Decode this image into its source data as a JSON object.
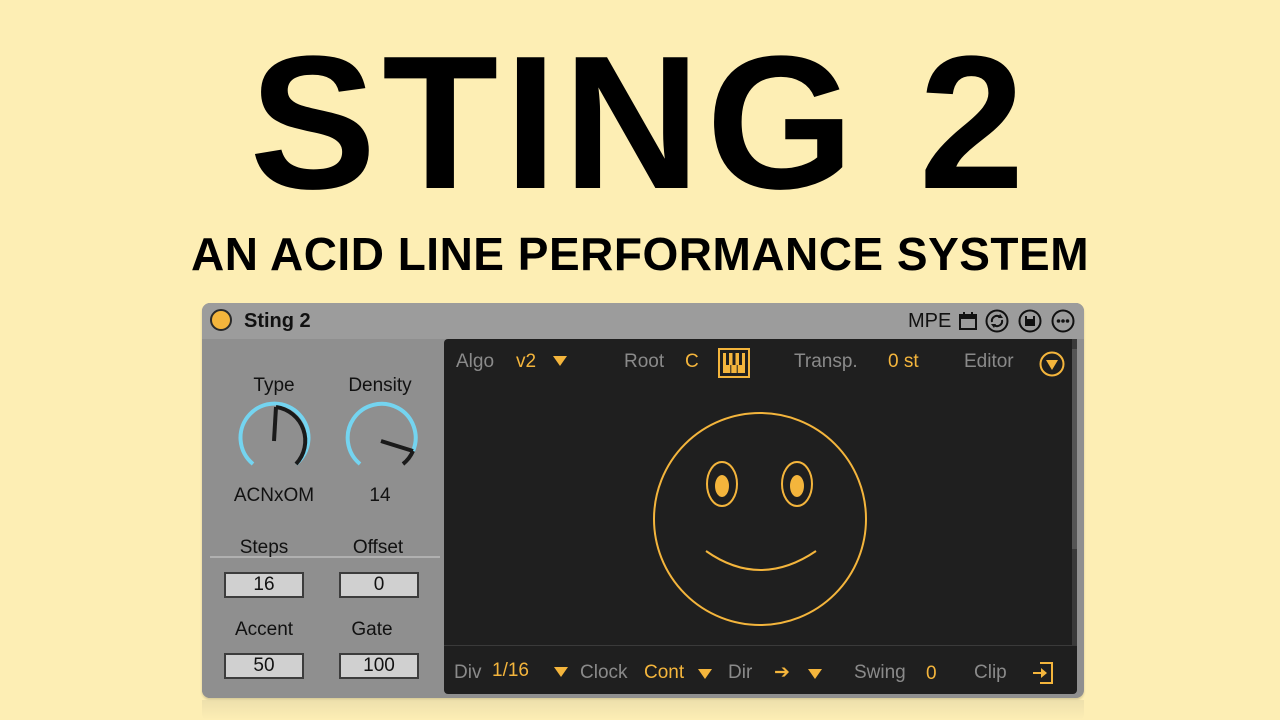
{
  "headline": "STING 2",
  "subheadline": "AN ACID LINE PERFORMANCE SYSTEM",
  "colors": {
    "background": "#fdeeb4",
    "accent": "#f4b53c",
    "knob_arc": "#74d4f0",
    "panel": "#1f1f1f"
  },
  "device": {
    "title": "Sting 2",
    "mpe_label": "MPE",
    "titlebar_icons": [
      "calendar-icon",
      "hot-swap-icon",
      "save-icon",
      "more-icon"
    ]
  },
  "left_panel": {
    "type": {
      "label": "Type",
      "value": "ACNxOM"
    },
    "density": {
      "label": "Density",
      "value": "14"
    },
    "steps": {
      "label": "Steps",
      "value": "16"
    },
    "offset": {
      "label": "Offset",
      "value": "0"
    },
    "accent": {
      "label": "Accent",
      "value": "50"
    },
    "gate": {
      "label": "Gate",
      "value": "100"
    }
  },
  "top_bar": {
    "algo_label": "Algo",
    "algo_value": "v2",
    "root_label": "Root",
    "root_value": "C",
    "transp_label": "Transp.",
    "transp_value": "0 st",
    "editor_label": "Editor"
  },
  "bottom_bar": {
    "div_label": "Div",
    "div_value": "1/16",
    "clock_label": "Clock",
    "clock_value": "Cont",
    "dir_label": "Dir",
    "dir_value": "➔",
    "swing_label": "Swing",
    "swing_value": "0",
    "clip_label": "Clip"
  }
}
